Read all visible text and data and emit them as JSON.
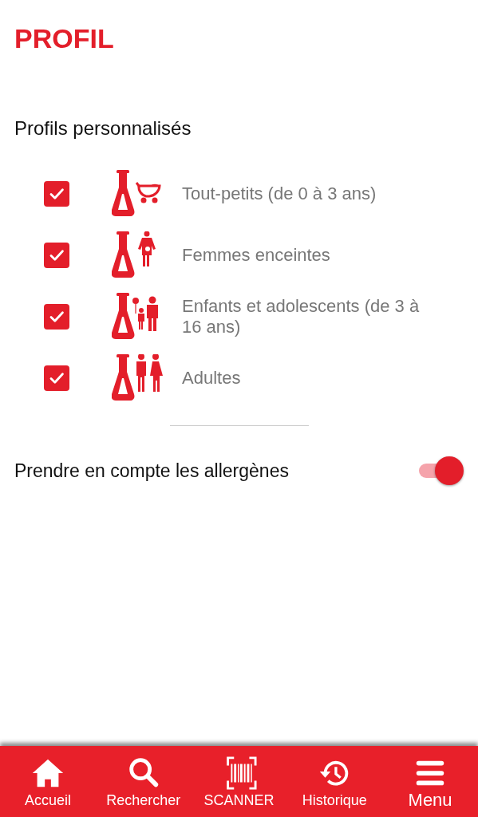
{
  "title": "PROFIL",
  "section_title": "Profils personnalisés",
  "profiles": [
    {
      "label": "Tout-petits (de 0 à 3 ans)",
      "checked": true,
      "kind": "baby"
    },
    {
      "label": "Femmes enceintes",
      "checked": true,
      "kind": "pregnant"
    },
    {
      "label": "Enfants et adolescents (de 3 à 16 ans)",
      "checked": true,
      "kind": "children"
    },
    {
      "label": "Adultes",
      "checked": true,
      "kind": "adults"
    }
  ],
  "allergens": {
    "label": "Prendre en compte les allergènes",
    "on": true
  },
  "nav": [
    {
      "label": "Accueil",
      "kind": "home"
    },
    {
      "label": "Rechercher",
      "kind": "search"
    },
    {
      "label": "SCANNER",
      "kind": "scanner"
    },
    {
      "label": "Historique",
      "kind": "history"
    },
    {
      "label": "Menu",
      "kind": "menu"
    }
  ]
}
